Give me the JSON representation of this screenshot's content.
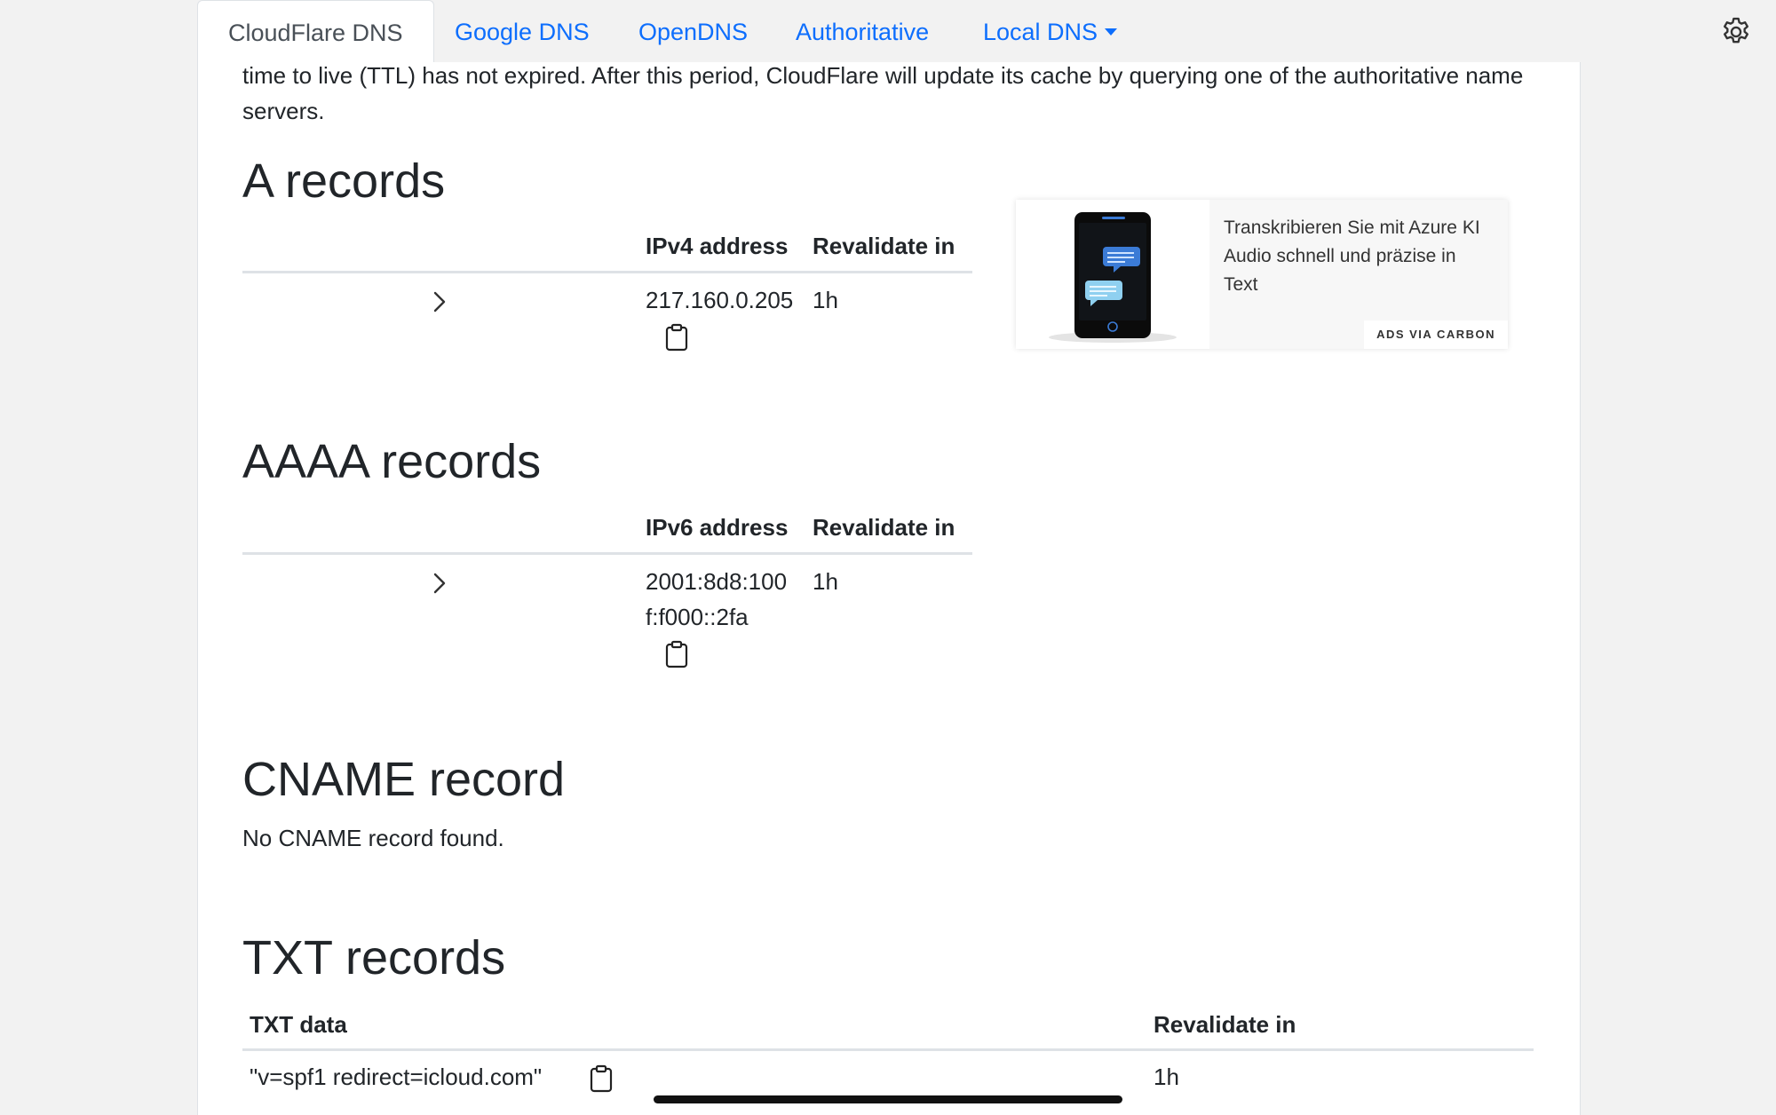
{
  "tabs": [
    {
      "label": "CloudFlare DNS",
      "active": true
    },
    {
      "label": "Google DNS"
    },
    {
      "label": "OpenDNS"
    },
    {
      "label": "Authoritative"
    },
    {
      "label": "Local DNS"
    }
  ],
  "settings_icon": "gear-icon",
  "intro_text": "time to live (TTL) has not expired. After this period, CloudFlare will update its cache by querying one of the authoritative name servers.",
  "a_records": {
    "title": "A records",
    "col_address": "IPv4 address",
    "col_revalidate": "Revalidate in",
    "rows": [
      {
        "address": "217.160.0.205",
        "revalidate": "1h"
      }
    ]
  },
  "aaaa_records": {
    "title": "AAAA records",
    "col_address": "IPv6 address",
    "col_revalidate": "Revalidate in",
    "rows": [
      {
        "address_line1": "2001:8d8:100",
        "address_line2": "f:f000::2fa",
        "revalidate": "1h"
      }
    ]
  },
  "cname_record": {
    "title": "CNAME record",
    "message": "No CNAME record found."
  },
  "txt_records": {
    "title": "TXT records",
    "col_data": "TXT data",
    "col_revalidate": "Revalidate in",
    "rows": [
      {
        "data": "\"v=spf1 redirect=icloud.com\"",
        "revalidate": "1h"
      }
    ]
  },
  "ad": {
    "text": "Transkribieren Sie mit Azure KI Audio schnell und präzise in Text",
    "via": "ADS VIA CARBON"
  },
  "colors": {
    "link": "#0d6efd",
    "text": "#212529",
    "border": "#dee2e6",
    "background": "#f2f2f2"
  }
}
